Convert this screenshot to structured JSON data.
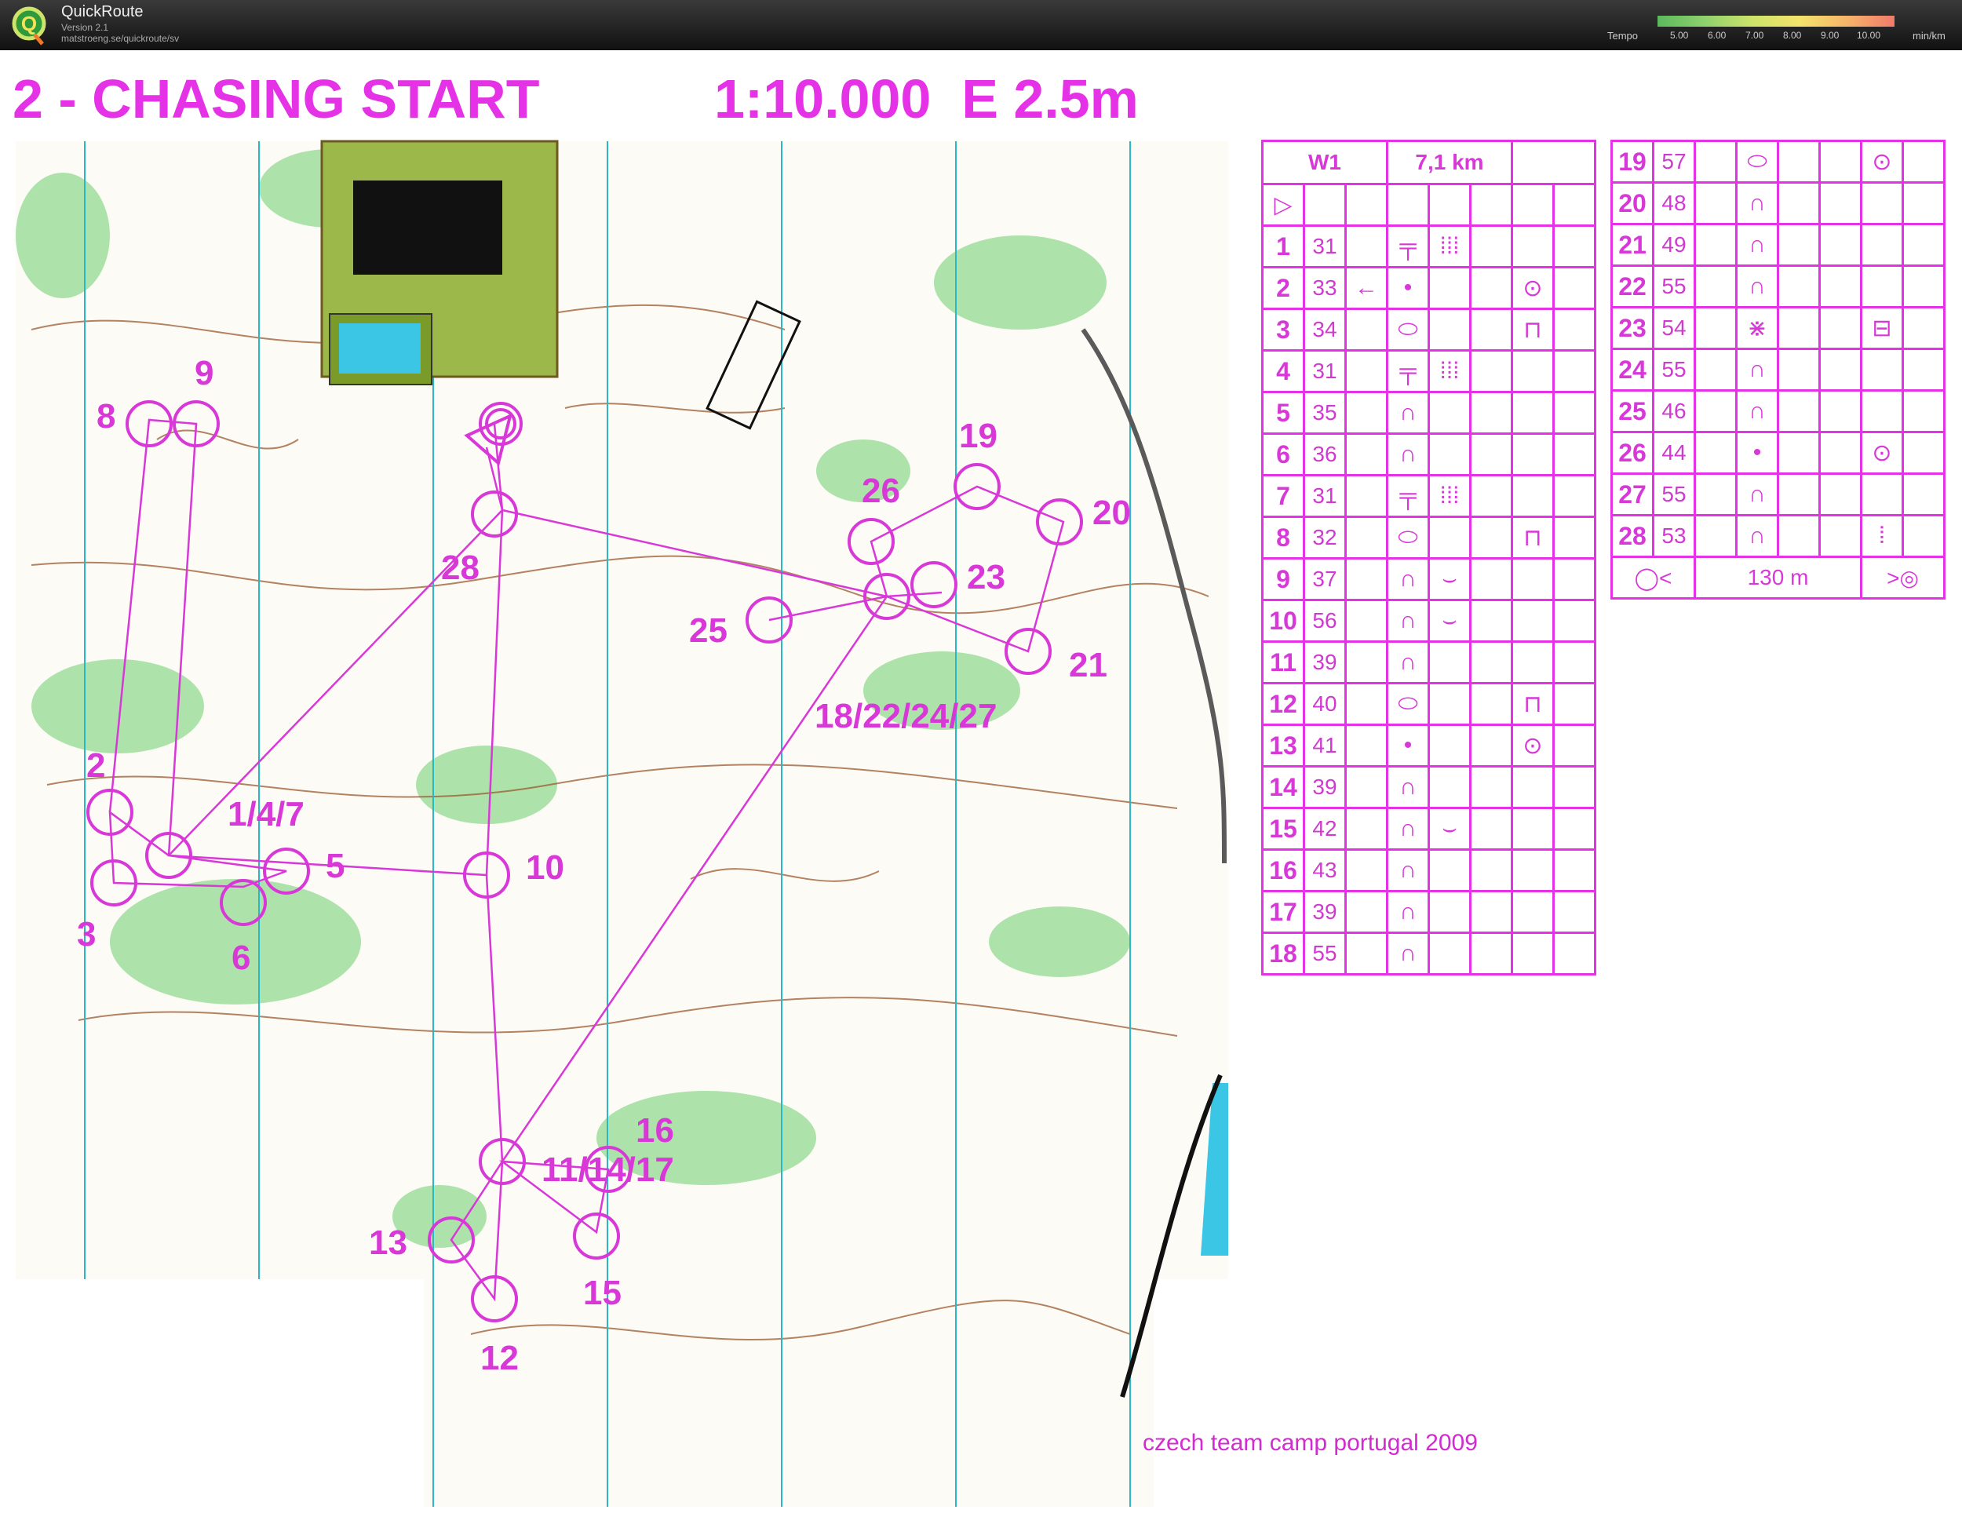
{
  "app": {
    "name": "QuickRoute",
    "version": "Version 2.1",
    "url": "matstroeng.se/quickroute/sv"
  },
  "tempo": {
    "label": "Tempo",
    "ticks": [
      "5.00",
      "6.00",
      "7.00",
      "8.00",
      "9.00",
      "10.00"
    ],
    "unit": "min/km"
  },
  "map": {
    "title": "2 - CHASING START",
    "scale": "1:10.000  E 2.5m",
    "credit": "czech team camp portugal 2009",
    "control_labels": [
      "1/4/7",
      "2",
      "3",
      "5",
      "6",
      "8",
      "9",
      "10",
      "11/14/17",
      "12",
      "13",
      "15",
      "16",
      "18/22/24/27",
      "19",
      "20",
      "21",
      "23",
      "25",
      "26",
      "28"
    ]
  },
  "description_sheet": {
    "class": "W1",
    "length": "7,1 km",
    "finish_distance": "130 m",
    "controls_left": [
      {
        "num": "1",
        "code": "31",
        "sym1": "╤",
        "sym2": "⁞⁞⁞",
        "sym3": ""
      },
      {
        "num": "2",
        "code": "33",
        "dir": "←",
        "sym1": "•",
        "sym2": "",
        "sym3": "⊙"
      },
      {
        "num": "3",
        "code": "34",
        "sym1": "⬭",
        "sym2": "",
        "sym3": "⊓"
      },
      {
        "num": "4",
        "code": "31",
        "sym1": "╤",
        "sym2": "⁞⁞⁞",
        "sym3": ""
      },
      {
        "num": "5",
        "code": "35",
        "sym1": "∩",
        "sym2": "",
        "sym3": ""
      },
      {
        "num": "6",
        "code": "36",
        "sym1": "∩",
        "sym2": "",
        "sym3": ""
      },
      {
        "num": "7",
        "code": "31",
        "sym1": "╤",
        "sym2": "⁞⁞⁞",
        "sym3": ""
      },
      {
        "num": "8",
        "code": "32",
        "sym1": "⬭",
        "sym2": "",
        "sym3": "⊓"
      },
      {
        "num": "9",
        "code": "37",
        "sym1": "∩",
        "sym2": "⌣",
        "sym3": ""
      },
      {
        "num": "10",
        "code": "56",
        "sym1": "∩",
        "sym2": "⌣",
        "sym3": ""
      },
      {
        "num": "11",
        "code": "39",
        "sym1": "∩",
        "sym2": "",
        "sym3": ""
      },
      {
        "num": "12",
        "code": "40",
        "sym1": "⬭",
        "sym2": "",
        "sym3": "⊓"
      },
      {
        "num": "13",
        "code": "41",
        "sym1": "•",
        "sym2": "",
        "sym3": "⊙"
      },
      {
        "num": "14",
        "code": "39",
        "sym1": "∩",
        "sym2": "",
        "sym3": ""
      },
      {
        "num": "15",
        "code": "42",
        "sym1": "∩",
        "sym2": "⌣",
        "sym3": ""
      },
      {
        "num": "16",
        "code": "43",
        "sym1": "∩",
        "sym2": "",
        "sym3": ""
      },
      {
        "num": "17",
        "code": "39",
        "sym1": "∩",
        "sym2": "",
        "sym3": ""
      },
      {
        "num": "18",
        "code": "55",
        "sym1": "∩",
        "sym2": "",
        "sym3": ""
      }
    ],
    "controls_right": [
      {
        "num": "19",
        "code": "57",
        "sym1": "⬭",
        "sym2": "",
        "sym3": "⊙"
      },
      {
        "num": "20",
        "code": "48",
        "sym1": "∩",
        "sym2": "",
        "sym3": ""
      },
      {
        "num": "21",
        "code": "49",
        "sym1": "∩",
        "sym2": "",
        "sym3": ""
      },
      {
        "num": "22",
        "code": "55",
        "sym1": "∩",
        "sym2": "",
        "sym3": ""
      },
      {
        "num": "23",
        "code": "54",
        "sym1": "⋇",
        "sym2": "",
        "sym3": "⊟"
      },
      {
        "num": "24",
        "code": "55",
        "sym1": "∩",
        "sym2": "",
        "sym3": ""
      },
      {
        "num": "25",
        "code": "46",
        "sym1": "∩",
        "sym2": "",
        "sym3": ""
      },
      {
        "num": "26",
        "code": "44",
        "sym1": "•",
        "sym2": "",
        "sym3": "⊙"
      },
      {
        "num": "27",
        "code": "55",
        "sym1": "∩",
        "sym2": "",
        "sym3": ""
      },
      {
        "num": "28",
        "code": "53",
        "sym1": "∩",
        "sym2": "",
        "sym3": "⦙"
      }
    ]
  }
}
